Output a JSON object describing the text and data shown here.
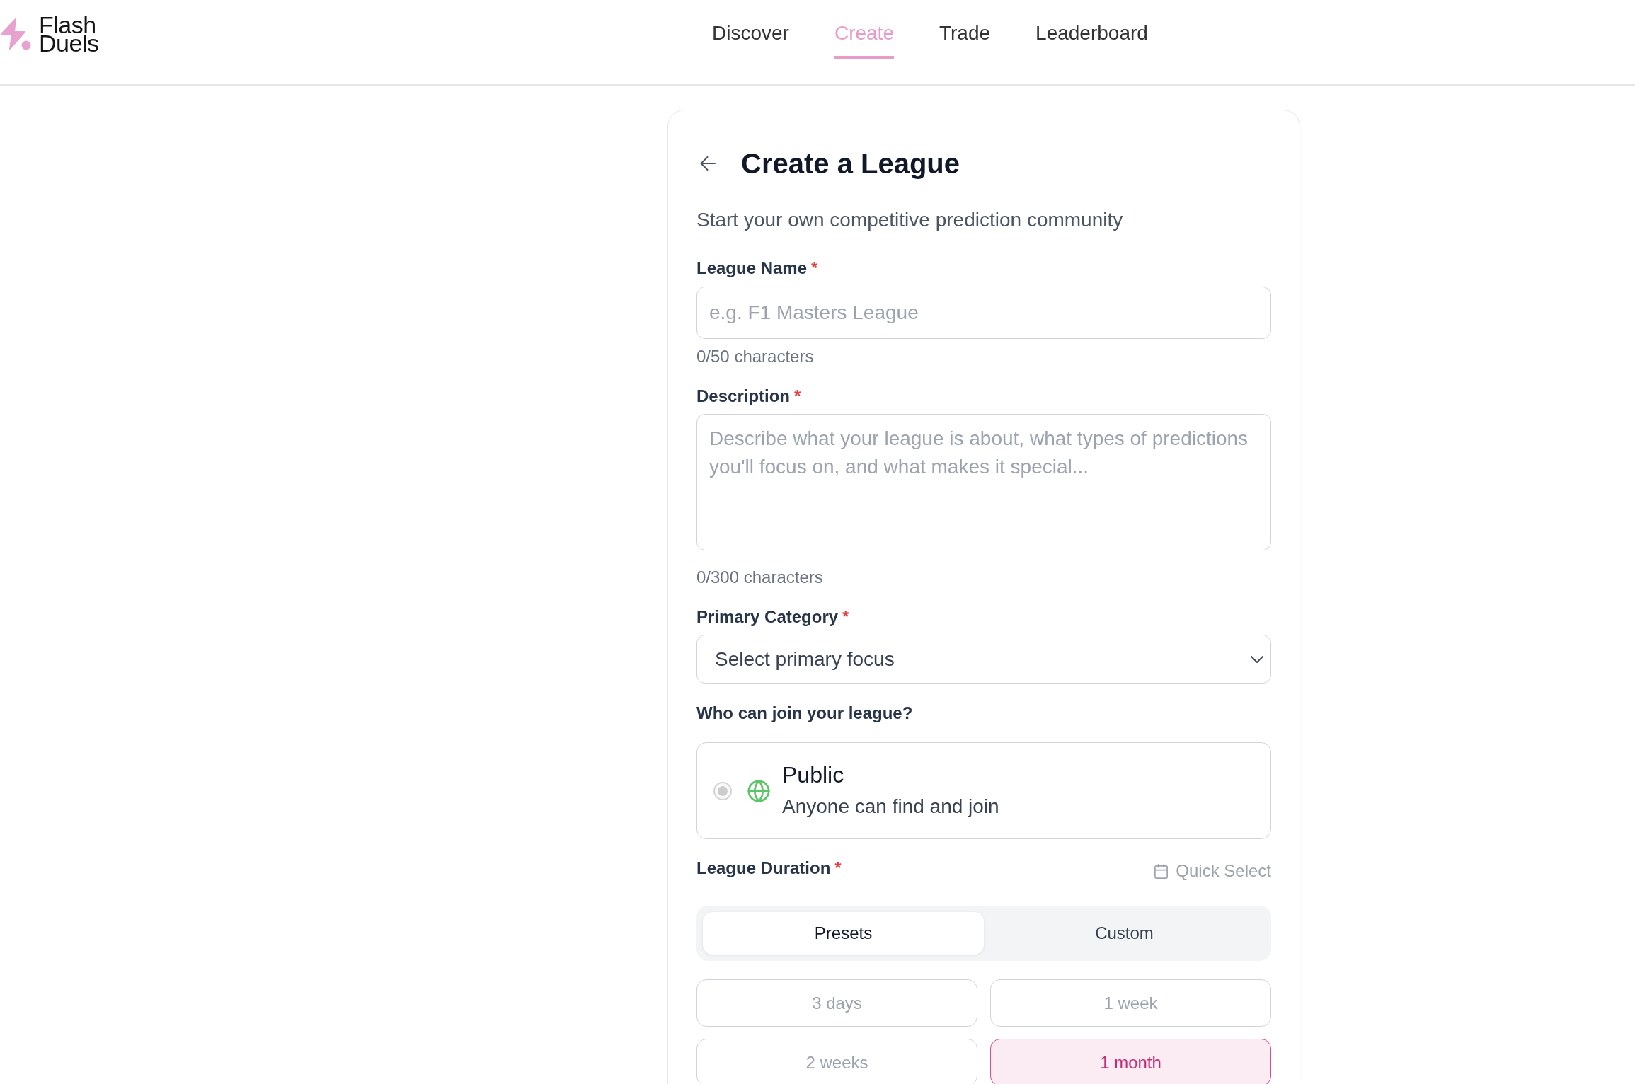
{
  "header": {
    "logo": {
      "lines": [
        "Flash",
        "Duels"
      ]
    },
    "nav": [
      {
        "label": "Discover",
        "selected": false
      },
      {
        "label": "Create",
        "selected": true
      },
      {
        "label": "Trade",
        "selected": false
      },
      {
        "label": "Leaderboard",
        "selected": false
      }
    ]
  },
  "form": {
    "title": "Create a League",
    "subtitle": "Start your own competitive prediction community",
    "league_name": {
      "label": "League Name",
      "required_mark": "*",
      "placeholder": "e.g. F1 Masters League",
      "counter": "0/50 characters"
    },
    "description": {
      "label": "Description",
      "required_mark": "*",
      "placeholder": "Describe what your league is about, what types of predictions you'll focus on, and what makes it special...",
      "counter": "0/300 characters"
    },
    "primary_category": {
      "label": "Primary Category",
      "required_mark": "*",
      "value": "Select primary focus"
    },
    "visibility": {
      "label": "Who can join your league?",
      "options": [
        {
          "title": "Public",
          "description": "Anyone can find and join",
          "selected": true,
          "disabled": true
        }
      ]
    },
    "duration": {
      "label": "League Duration",
      "required_mark": "*",
      "quick_select": "Quick Select",
      "modes": [
        {
          "label": "Presets",
          "selected": true
        },
        {
          "label": "Custom",
          "selected": false
        }
      ],
      "presets": [
        {
          "label": "3 days",
          "selected": false
        },
        {
          "label": "1 week",
          "selected": false
        },
        {
          "label": "2 weeks",
          "selected": false
        },
        {
          "label": "1 month",
          "selected": true
        }
      ]
    }
  }
}
